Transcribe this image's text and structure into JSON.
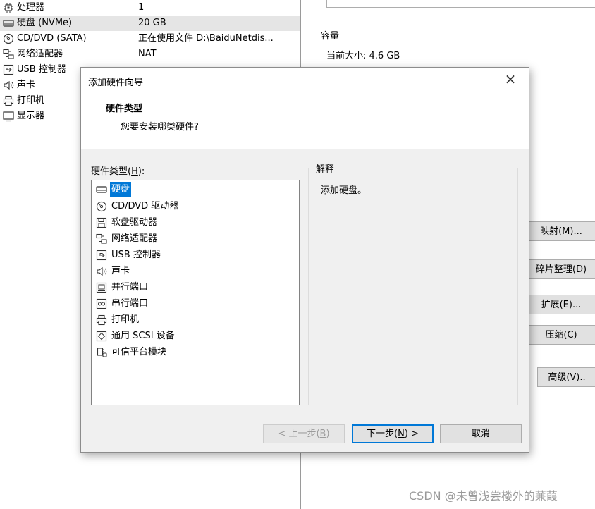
{
  "devices": [
    {
      "name": "处理器",
      "summary": "1",
      "icon": "cpu-icon"
    },
    {
      "name": "硬盘 (NVMe)",
      "summary": "20 GB",
      "icon": "hard-disk-icon",
      "selected": true
    },
    {
      "name": "CD/DVD (SATA)",
      "summary": "正在使用文件 D:\\BaiduNetdis...",
      "icon": "cd-dvd-icon"
    },
    {
      "name": "网络适配器",
      "summary": "NAT",
      "icon": "network-adapter-icon"
    },
    {
      "name": "USB 控制器",
      "summary": "",
      "icon": "usb-controller-icon"
    },
    {
      "name": "声卡",
      "summary": "",
      "icon": "sound-card-icon"
    },
    {
      "name": "打印机",
      "summary": "",
      "icon": "printer-icon"
    },
    {
      "name": "显示器",
      "summary": "",
      "icon": "display-icon"
    }
  ],
  "capacity": {
    "group_title": "容量",
    "current_size": "当前大小: 4.6 GB"
  },
  "side_buttons": {
    "map": "映射(M)...",
    "defrag": "碎片整理(D)",
    "expand": "扩展(E)...",
    "compact": "压缩(C)",
    "advanced": "高级(V).."
  },
  "dialog": {
    "title": "添加硬件向导",
    "close": "×",
    "header_title": "硬件类型",
    "header_subtitle": "您要安装哪类硬件?",
    "hw_label_prefix": "硬件类型(",
    "hw_label_key": "H",
    "hw_label_suffix": "):",
    "explain_title": "解释",
    "explain_text": "添加硬盘。",
    "hardware_types": [
      {
        "label": "硬盘",
        "icon": "hard-disk-icon",
        "selected": true
      },
      {
        "label": "CD/DVD 驱动器",
        "icon": "cd-dvd-icon"
      },
      {
        "label": "软盘驱动器",
        "icon": "floppy-icon"
      },
      {
        "label": "网络适配器",
        "icon": "network-adapter-icon"
      },
      {
        "label": "USB 控制器",
        "icon": "usb-controller-icon"
      },
      {
        "label": "声卡",
        "icon": "sound-card-icon"
      },
      {
        "label": "并行端口",
        "icon": "parallel-port-icon"
      },
      {
        "label": "串行端口",
        "icon": "serial-port-icon"
      },
      {
        "label": "打印机",
        "icon": "printer-icon"
      },
      {
        "label": "通用 SCSI 设备",
        "icon": "scsi-icon"
      },
      {
        "label": "可信平台模块",
        "icon": "tpm-icon"
      }
    ],
    "buttons": {
      "back_prefix": "< 上一步(",
      "back_key": "B",
      "back_suffix": ")",
      "next_prefix": "下一步(",
      "next_key": "N",
      "next_suffix": ") >",
      "cancel": "取消"
    }
  },
  "watermark": "CSDN @未曾浅尝楼外的蒹葭",
  "colors": {
    "selection": "#0078d7",
    "selected_row": "#e5e5e5",
    "dialog_bg": "#f0f0f0"
  }
}
